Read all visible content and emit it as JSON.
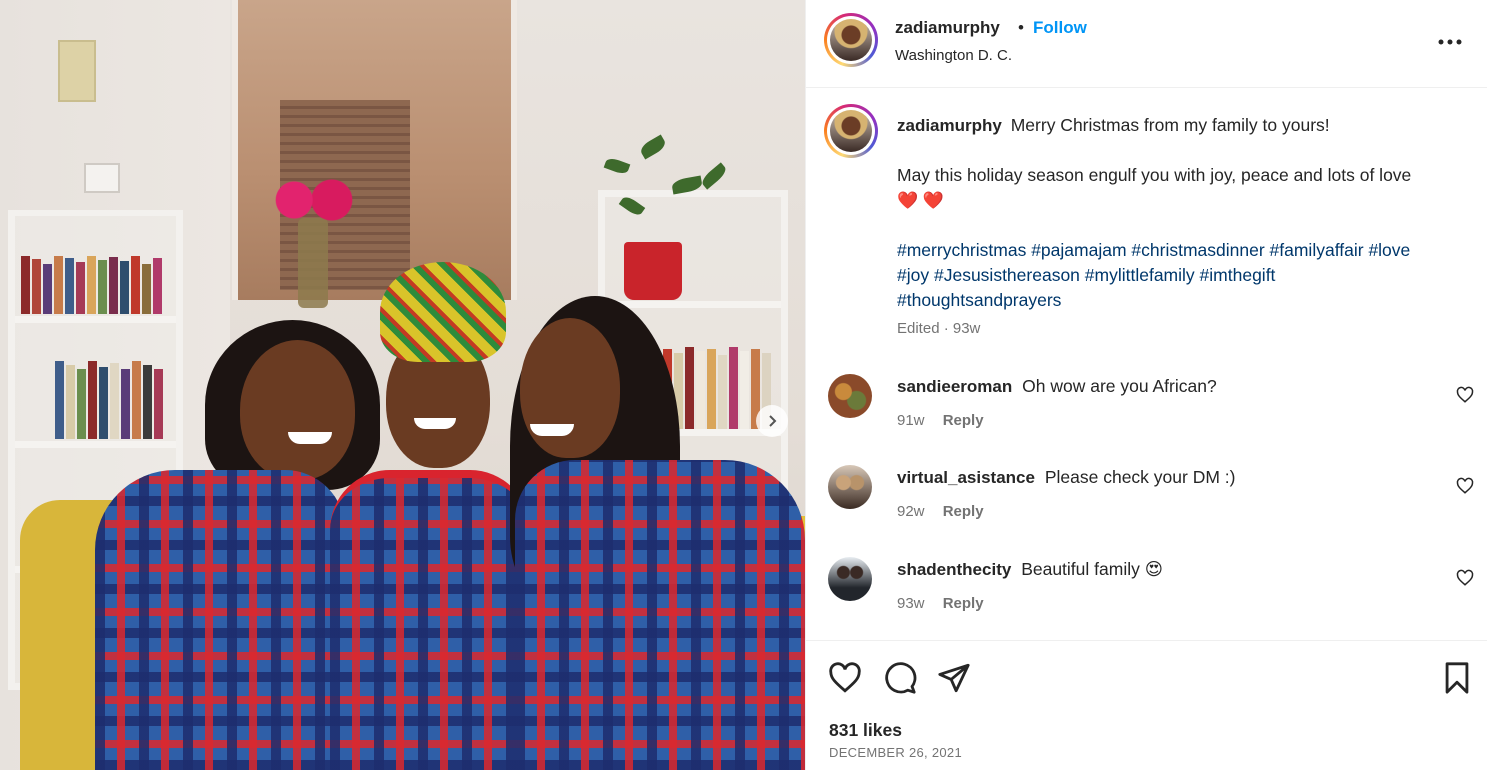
{
  "post": {
    "username": "zadiamurphy",
    "follow_label": "Follow",
    "separator": "•",
    "location": "Washington D. C.",
    "more_label": "•••"
  },
  "caption": {
    "username": "zadiamurphy",
    "line1": "Merry Christmas from my family to yours!",
    "line2": "May this holiday season engulf you with joy, peace and lots of love",
    "hearts": "❤️ ❤️",
    "hashtags": [
      "#merrychristmas",
      "#pajamajam",
      "#christmasdinner",
      "#familyaffair",
      "#love",
      "#joy",
      "#Jesusisthereason",
      "#mylittlefamily",
      "#imthegift",
      "#thoughtsandprayers"
    ],
    "meta": "Edited · 93w"
  },
  "comments": [
    {
      "username": "sandieeroman",
      "text": "Oh wow are you African?",
      "age": "91w",
      "reply_label": "Reply",
      "avatar_icon": "food-avatar"
    },
    {
      "username": "virtual_asistance",
      "text": "Please check your DM :)",
      "age": "92w",
      "reply_label": "Reply",
      "avatar_icon": "two-people-avatar"
    },
    {
      "username": "shadenthecity",
      "text": "Beautiful family",
      "emoji": "😍",
      "age": "93w",
      "reply_label": "Reply",
      "avatar_icon": "group-avatar"
    }
  ],
  "engagement": {
    "likes": "831 likes",
    "date": "DECEMBER 26, 2021"
  },
  "icons": {
    "like": "heart-icon",
    "comment": "comment-icon",
    "share": "send-icon",
    "save": "bookmark-icon",
    "next": "chevron-right-icon"
  },
  "colors": {
    "follow": "#0095f6",
    "hashtag": "#00376b",
    "secondary_text": "#737373",
    "primary_text": "#262626"
  }
}
